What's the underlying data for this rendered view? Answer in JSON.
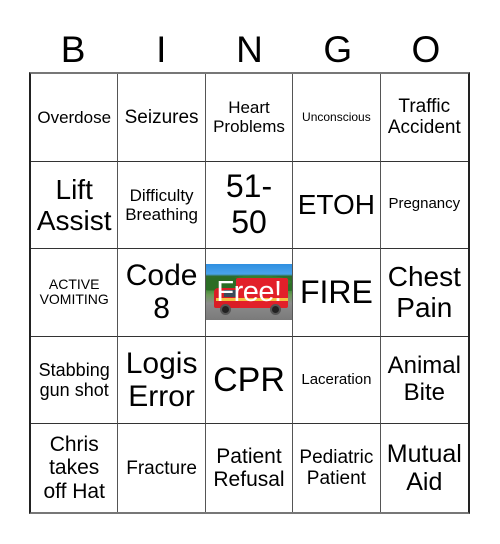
{
  "header": {
    "letters": [
      "B",
      "I",
      "N",
      "G",
      "O"
    ]
  },
  "free_space": {
    "label": "Free!",
    "image": "ambulance-photo"
  },
  "rows": [
    [
      {
        "lines": [
          "Overdose"
        ]
      },
      {
        "lines": [
          "Seizures"
        ]
      },
      {
        "lines": [
          "Heart",
          "Problems"
        ]
      },
      {
        "lines": [
          "Unconscious"
        ]
      },
      {
        "lines": [
          "Traffic",
          "Accident"
        ]
      }
    ],
    [
      {
        "lines": [
          "Lift",
          "Assist"
        ]
      },
      {
        "lines": [
          "Difficulty",
          "Breathing"
        ]
      },
      {
        "lines": [
          "51-",
          "50"
        ]
      },
      {
        "lines": [
          "ETOH"
        ]
      },
      {
        "lines": [
          "Pregnancy"
        ]
      }
    ],
    [
      {
        "lines": [
          "ACTIVE",
          "VOMITING"
        ]
      },
      {
        "lines": [
          "Code",
          "8"
        ]
      },
      {
        "lines": [
          "Free!"
        ]
      },
      {
        "lines": [
          "FIRE"
        ]
      },
      {
        "lines": [
          "Chest",
          "Pain"
        ]
      }
    ],
    [
      {
        "lines": [
          "Stabbing",
          "gun shot"
        ]
      },
      {
        "lines": [
          "Logis",
          "Error"
        ]
      },
      {
        "lines": [
          "CPR"
        ]
      },
      {
        "lines": [
          "Laceration"
        ]
      },
      {
        "lines": [
          "Animal",
          "Bite"
        ]
      }
    ],
    [
      {
        "lines": [
          "Chris",
          "takes",
          "off Hat"
        ]
      },
      {
        "lines": [
          "Fracture"
        ]
      },
      {
        "lines": [
          "Patient",
          "Refusal"
        ]
      },
      {
        "lines": [
          "Pediatric",
          "Patient"
        ]
      },
      {
        "lines": [
          "Mutual",
          "Aid"
        ]
      }
    ]
  ]
}
